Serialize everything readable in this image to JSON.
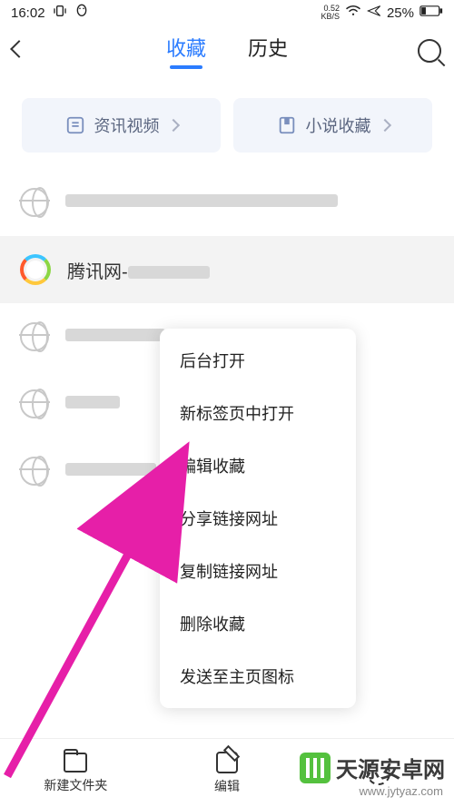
{
  "status": {
    "time": "16:02",
    "speed_val": "0.52",
    "speed_unit": "KB/S",
    "battery": "25%"
  },
  "nav": {
    "tabs": [
      {
        "label": "收藏",
        "active": true
      },
      {
        "label": "历史",
        "active": false
      }
    ]
  },
  "categories": [
    {
      "label": "资讯视频",
      "icon": "news-icon"
    },
    {
      "label": "小说收藏",
      "icon": "novel-icon"
    }
  ],
  "list": [
    {
      "title_hidden": true,
      "selected": false,
      "icon": "globe"
    },
    {
      "title": "腾讯网-",
      "selected": true,
      "icon": "qq"
    },
    {
      "title_hidden": true,
      "selected": false,
      "icon": "globe"
    },
    {
      "title_hidden": true,
      "selected": false,
      "icon": "globe"
    },
    {
      "title_hidden": true,
      "selected": false,
      "icon": "globe"
    }
  ],
  "context_menu": [
    "后台打开",
    "新标签页中打开",
    "编辑收藏",
    "分享链接网址",
    "复制链接网址",
    "删除收藏",
    "发送至主页图标"
  ],
  "bottom": {
    "new_folder": "新建文件夹",
    "edit": "编辑",
    "reset": ""
  },
  "watermark": {
    "brand": "天源安卓网",
    "url": "www.jytyaz.com"
  }
}
